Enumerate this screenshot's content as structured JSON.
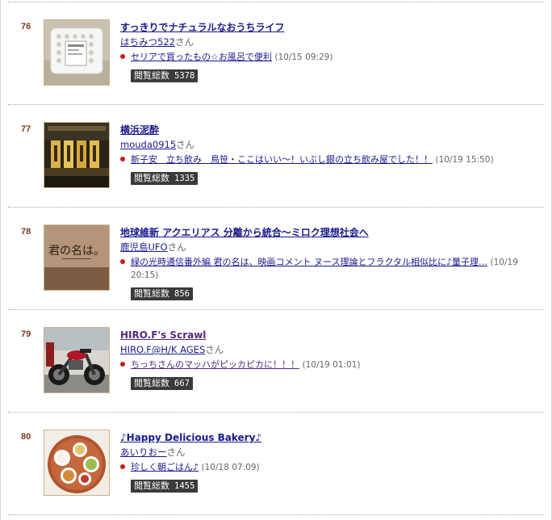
{
  "ranking": [
    {
      "rank": "76",
      "thumbnail": "laundry-basket-photo",
      "title": "すっきりでナチュラルなおうちライフ",
      "author": "はちみつ522",
      "honorific": "さん",
      "post_title": "セリアで買ったもの☆お風呂で便利",
      "post_date": "(10/15 09:29)",
      "views_label": "閲覧総数",
      "views": "5378"
    },
    {
      "rank": "77",
      "thumbnail": "izakaya-street-photo",
      "title": "横浜泥酔",
      "author": "mouda0915",
      "honorific": "さん",
      "post_title": "新子安　立ち飲み　鳥笹・ここはいい〜！いぶし銀の立ち飲み屋でした！！",
      "post_date": "(10/19 15:50)",
      "views_label": "閲覧総数",
      "views": "1335"
    },
    {
      "rank": "78",
      "thumbnail": "kimi-no-na-wa-sign-photo",
      "thumbnail_text": "君の名は。",
      "title": "地球維新 アクエリアス 分離から統合〜ミロク理想社会へ",
      "author": "鹿児島UFO",
      "honorific": "さん",
      "post_title": "緑の光時通信番外編 君の名は、映画コメント ヌース理論とフラクタル相似比に♪量子理…",
      "post_date": "(10/19 20:15)",
      "views_label": "閲覧総数",
      "views": "856"
    },
    {
      "rank": "79",
      "thumbnail": "motorcycle-photo",
      "title": "HIRO.F's Scrawl",
      "author": "HIRO.F@H/K AGES",
      "honorific": "さん",
      "post_title": "ちっちさんのマッハがピッカピカに！！！",
      "post_date": "(10/19 01:01)",
      "views_label": "閲覧総数",
      "views": "667"
    },
    {
      "rank": "80",
      "thumbnail": "breakfast-plate-photo",
      "title": "♪Happy Delicious Bakery♪",
      "author": "あいりおー",
      "honorific": "さん",
      "post_title": "珍しく朝ごはん♪",
      "post_date": "(10/18 07:09)",
      "views_label": "閲覧総数",
      "views": "1455"
    }
  ],
  "colors": {
    "link": "#1a1a8c",
    "visited_link": "#552a80",
    "rank_number": "#7a3b20",
    "bullet": "#cc1b1b",
    "views_badge_bg": "#3a3a3a",
    "thumb_border": "#c9b48a"
  }
}
